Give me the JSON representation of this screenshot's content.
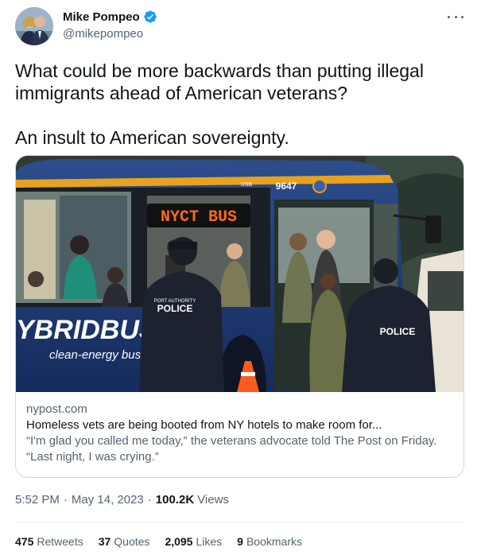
{
  "author": {
    "display_name": "Mike Pompeo",
    "handle": "@mikepompeo",
    "verified_icon": "verified-badge-icon",
    "verified_color": "#1d9bf0"
  },
  "tweet": {
    "text": "What could be more backwards than putting illegal immigrants ahead of American veterans?\n\nAn insult to American sovereignty."
  },
  "card": {
    "image": {
      "bus_route_sign": "NYCT BUS",
      "bus_number": "9647",
      "usb_label": "USB",
      "bus_branding": "YBRIDBUS",
      "bus_tagline": "clean-energy bus",
      "officer_vest_left": "PORT AUTHORITY POLICE",
      "officer_vest_right": "POLICE"
    },
    "domain": "nypost.com",
    "title": "Homeless vets are being booted from NY hotels to make room for...",
    "description": "“I'm glad you called me today,” the veterans advocate told The Post on Friday. “Last night, I was crying.”"
  },
  "meta": {
    "time": "5:52 PM",
    "separator": "·",
    "date": "May 14, 2023",
    "views_count": "100.2K",
    "views_label": "Views"
  },
  "stats": {
    "retweets_count": "475",
    "retweets_label": "Retweets",
    "quotes_count": "37",
    "quotes_label": "Quotes",
    "likes_count": "2,095",
    "likes_label": "Likes",
    "bookmarks_count": "9",
    "bookmarks_label": "Bookmarks"
  },
  "colors": {
    "text_primary": "#0f1419",
    "text_secondary": "#536471",
    "border": "#cfd9de",
    "bus_sign": "#ff6a1a"
  }
}
